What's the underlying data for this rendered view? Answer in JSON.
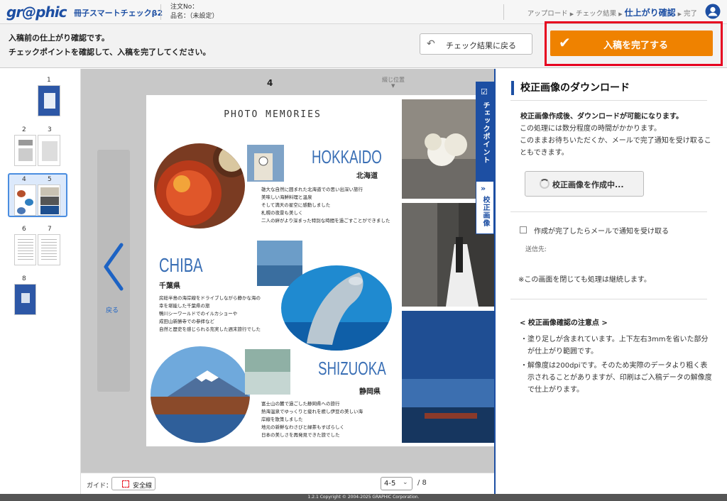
{
  "header": {
    "logo": "gr@phic",
    "app_name": "冊子スマートチェックβ2",
    "order_no_label": "注文No：",
    "product_label": "品名：（未設定）",
    "steps": [
      "アップロード",
      "チェック結果",
      "仕上がり確認",
      "完了"
    ]
  },
  "actionbar": {
    "message_line1": "入稿前の仕上がり確認です。",
    "message_line2": "チェックポイントを確認して、入稿を完了してください。",
    "back_label": "チェック結果に戻る",
    "complete_label": "入稿を完了する"
  },
  "thumbnails": {
    "labels": [
      "1",
      "2",
      "3",
      "4",
      "5",
      "6",
      "7",
      "8"
    ],
    "selected": "4-5"
  },
  "viewer": {
    "page_number": "4",
    "spine_label": "綴じ位置",
    "back_label": "戻る",
    "tab_checkpoint": "チェックポイント",
    "tab_proof": "校正画像",
    "page_content": {
      "heading": "PHOTO MEMORIES",
      "sections": [
        {
          "title": "HOKKAIDO",
          "subtitle": "北海道",
          "lines": [
            "雄大な自然に囲まれた北海道での思い出深い旅行",
            "美味しい海鮮料理と温泉",
            "そして満天の星空に感動しました",
            "札幌の夜景も美しく",
            "二人の絆がより深まった特別な時間を過ごすことができました"
          ]
        },
        {
          "title": "CHIBA",
          "subtitle": "千葉県",
          "lines": [
            "房総半島の海岸線をドライブしながら静かな海の",
            "幸を堪能した千葉県の旅",
            "鴨川シーワールドでのイルカショーや",
            "成田山新勝寺での参拝など",
            "自然と歴史を感じられる充実した週末旅行でした"
          ]
        },
        {
          "title": "SHIZUOKA",
          "subtitle": "静岡県",
          "lines": [
            "富士山の麓で過ごした静岡県への旅行",
            "熱海温泉でゆっくりと疲れを癒し伊豆の美しい海",
            "岸線を散策しました",
            "地元の新鮮なわさびと緑茶もすばらしく",
            "日本の美しさを再発見できた旅でした"
          ]
        }
      ]
    }
  },
  "bottombar": {
    "guide_label": "ガイド：",
    "safe_line_label": "安全線",
    "page_select_value": "4-5",
    "page_total": "/ 8"
  },
  "rightpanel": {
    "title": "校正画像のダウンロード",
    "lead": "校正画像作成後、ダウンロードが可能になります。",
    "desc_line1": "この処理には数分程度の時間がかかります。",
    "desc_line2": "このままお待ちいただくか、メールで完了通知を受け取ることもできます。",
    "generating_label": "校正画像を作成中...",
    "notify_label": "作成が完了したらメールで通知を受け取る",
    "send_to_label": "送信先:",
    "continue_note": "※この画面を閉じても処理は継続します。",
    "notes_title": "< 校正画像確認の注意点 >",
    "notes": [
      "塗り足しが含まれています。上下左右3mmを省いた部分が仕上がり範囲です。",
      "解像度は200dpiです。そのため実際のデータより粗く表示されることがありますが、印刷はご入稿データの解像度で仕上がります。"
    ]
  },
  "footer": {
    "text": "1.2.1    Copyright © 2004-2025 GRAPHIC Corporation."
  },
  "colors": {
    "brand_blue": "#1d4fa3",
    "complete_orange": "#ef8200",
    "highlight_red": "#e6001f"
  }
}
